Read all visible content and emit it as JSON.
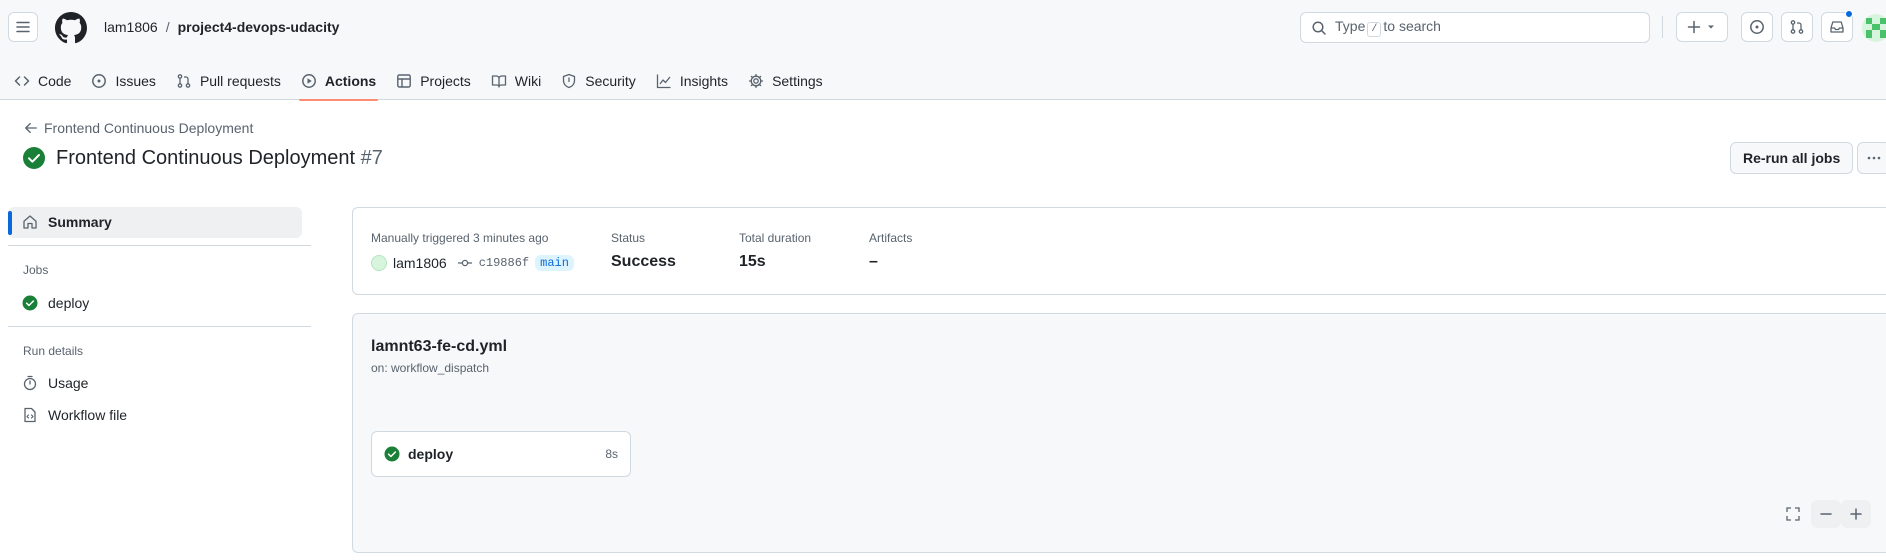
{
  "header": {
    "owner": "lam1806",
    "separator": "/",
    "repo": "project4-devops-udacity",
    "search": {
      "prefix": "Type",
      "key": "/",
      "suffix": "to search"
    }
  },
  "nav": {
    "tabs": [
      {
        "label": "Code",
        "icon": "code-icon"
      },
      {
        "label": "Issues",
        "icon": "issue-icon"
      },
      {
        "label": "Pull requests",
        "icon": "pull-request-icon"
      },
      {
        "label": "Actions",
        "icon": "play-icon",
        "active": true
      },
      {
        "label": "Projects",
        "icon": "table-icon"
      },
      {
        "label": "Wiki",
        "icon": "book-icon"
      },
      {
        "label": "Security",
        "icon": "shield-icon"
      },
      {
        "label": "Insights",
        "icon": "graph-icon"
      },
      {
        "label": "Settings",
        "icon": "gear-icon"
      }
    ]
  },
  "page": {
    "back_label": "Frontend Continuous Deployment",
    "title": "Frontend Continuous Deployment",
    "run_number": "#7",
    "rerun_label": "Re-run all jobs"
  },
  "sidebar": {
    "summary_label": "Summary",
    "jobs_heading": "Jobs",
    "jobs": [
      {
        "label": "deploy",
        "status": "success"
      }
    ],
    "run_details_heading": "Run details",
    "details": [
      {
        "label": "Usage"
      },
      {
        "label": "Workflow file"
      }
    ]
  },
  "summary": {
    "trigger_label": "Manually triggered 3 minutes ago",
    "actor": "lam1806",
    "sha": "c19886f",
    "branch": "main",
    "status_label": "Status",
    "status_value": "Success",
    "duration_label": "Total duration",
    "duration_value": "15s",
    "artifacts_label": "Artifacts",
    "artifacts_value": "–"
  },
  "workflow": {
    "file": "lamnt63-fe-cd.yml",
    "on": "on: workflow_dispatch",
    "job": {
      "name": "deploy",
      "duration": "8s",
      "status": "success"
    }
  },
  "colors": {
    "success": "#1a7f37",
    "accent": "#0969da",
    "tab_underline": "#fd8c73"
  }
}
